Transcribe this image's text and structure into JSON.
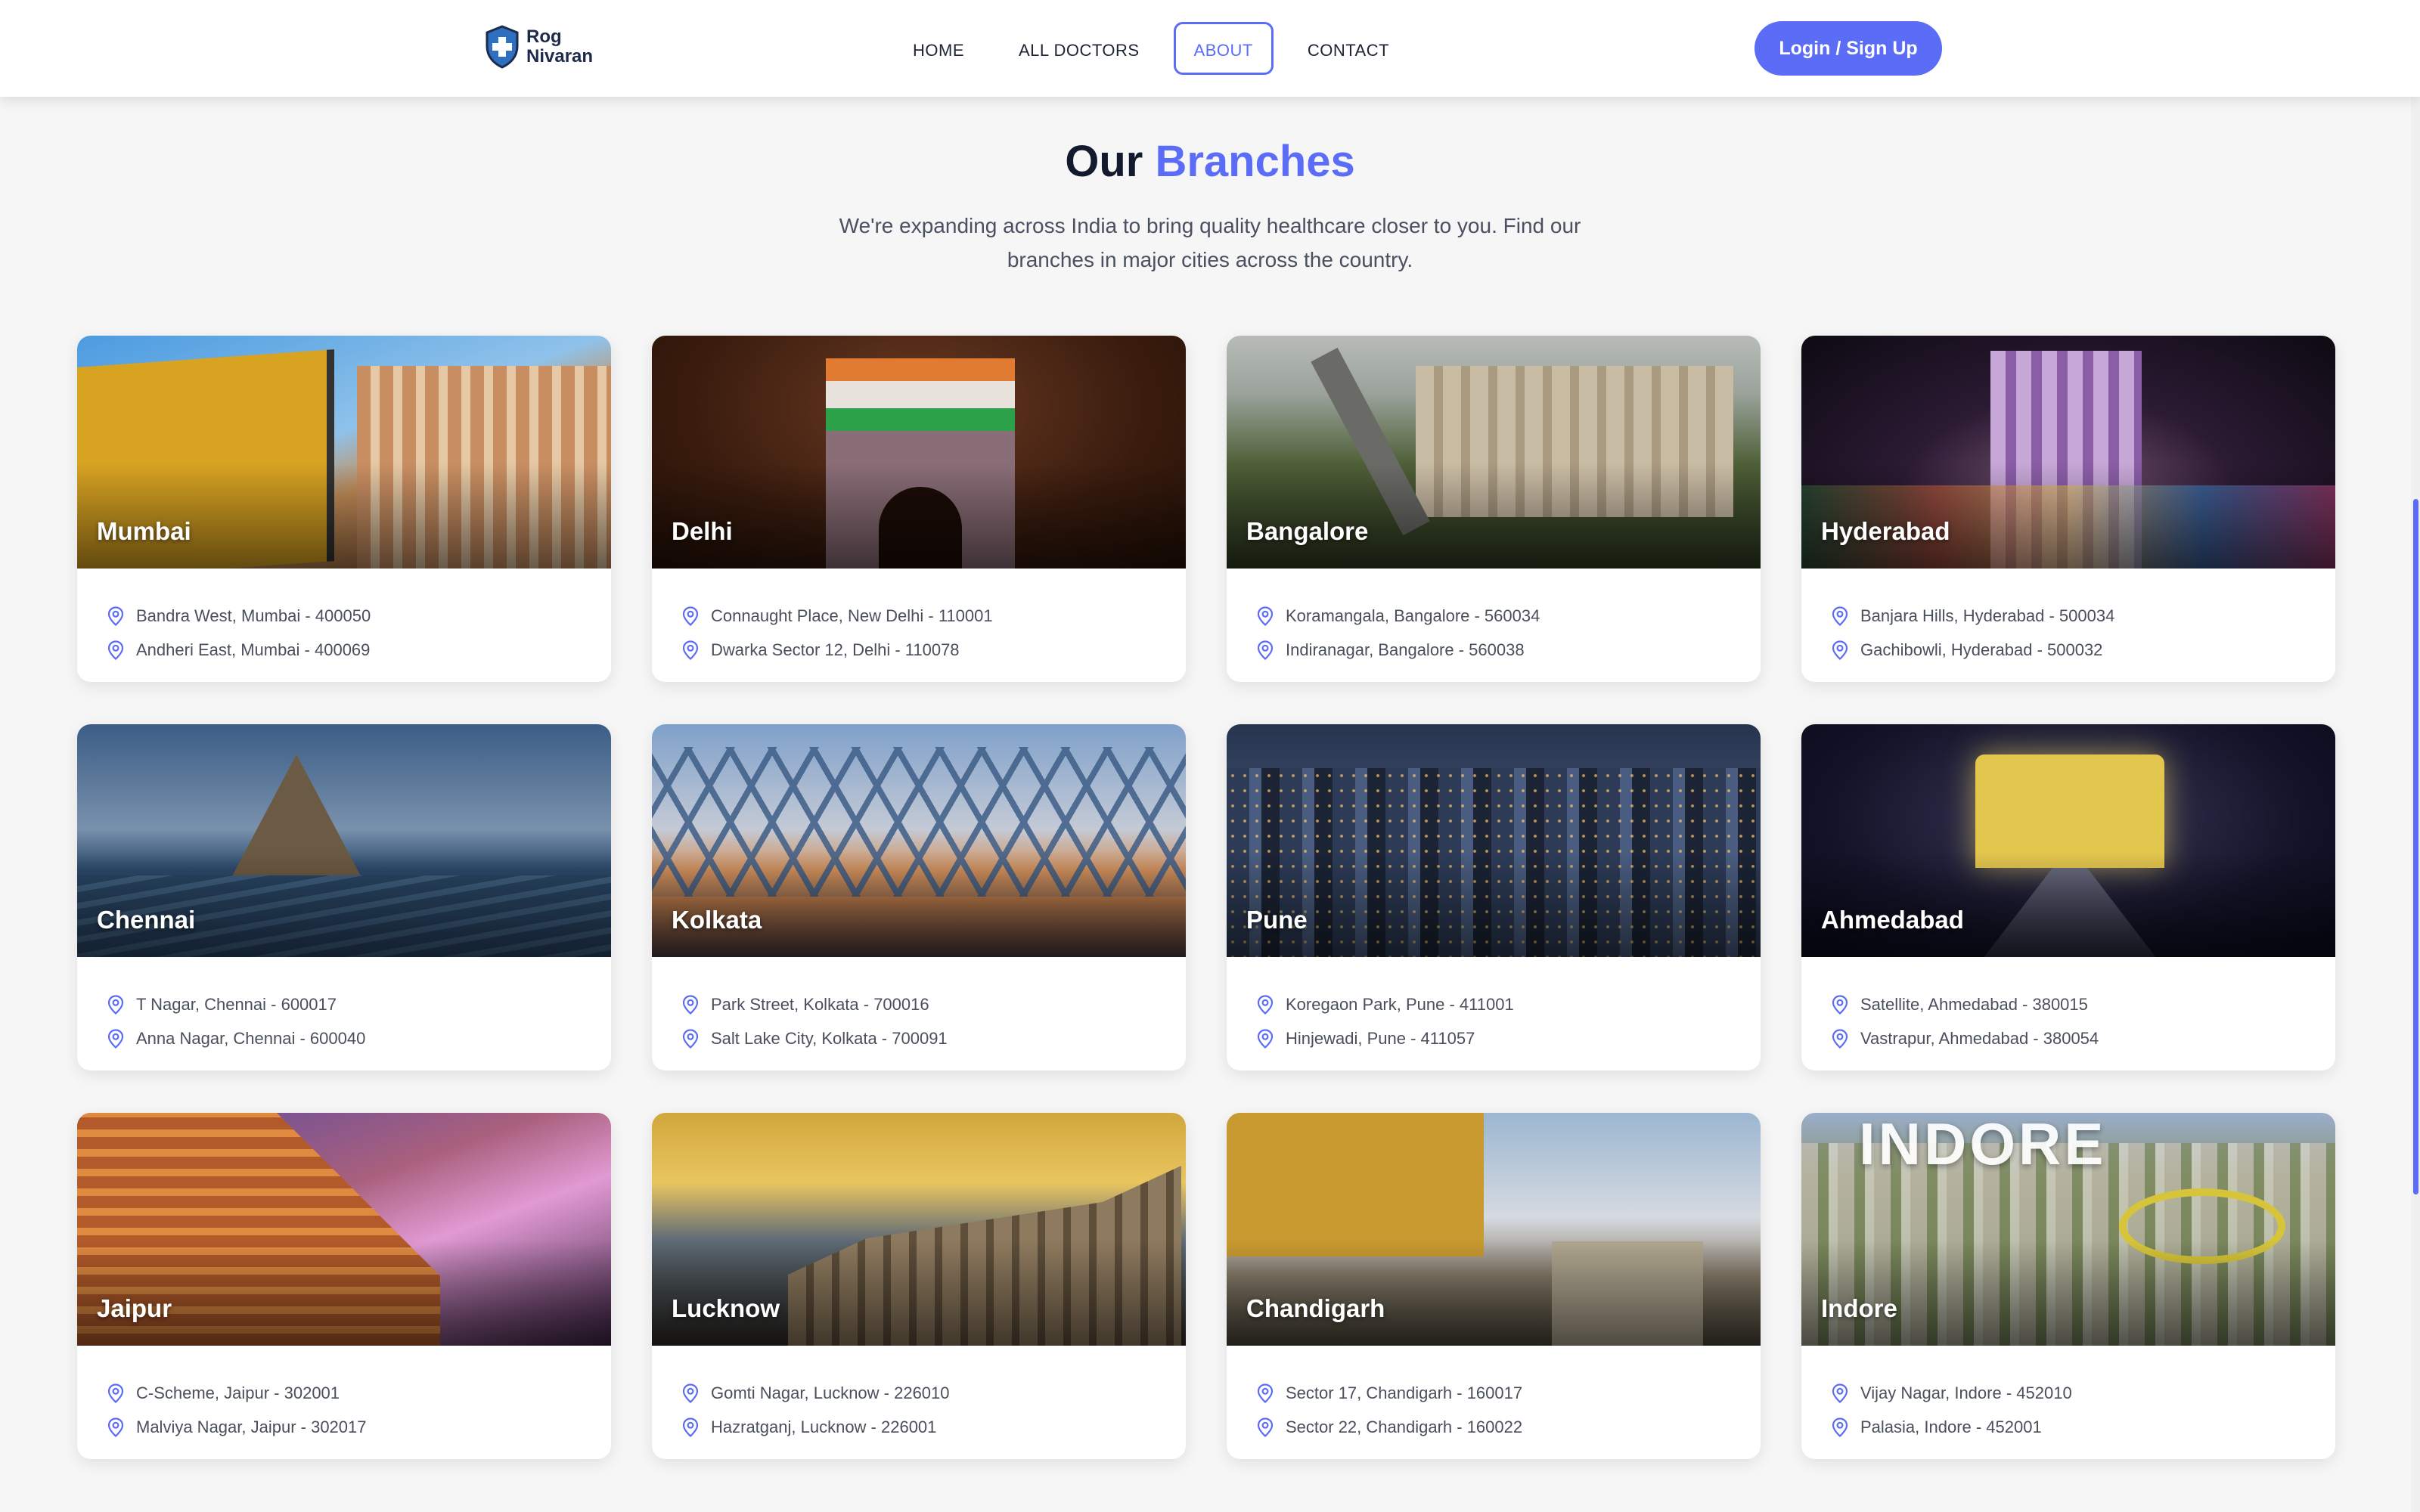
{
  "brand": {
    "line1": "Rog",
    "line2": "Nivaran"
  },
  "nav": {
    "links": [
      {
        "label": "HOME"
      },
      {
        "label": "ALL DOCTORS"
      },
      {
        "label": "ABOUT"
      },
      {
        "label": "CONTACT"
      }
    ],
    "active": "ABOUT",
    "login_label": "Login / Sign Up"
  },
  "colors": {
    "accent": "#5b6cf6",
    "heading": "#141a2e",
    "background": "#f6f6f7"
  },
  "section": {
    "title_plain": "Our",
    "title_accent": "Branches",
    "subtitle": "We're expanding across India to bring quality healthcare closer to you. Find our branches in major cities across the country."
  },
  "icons": {
    "address": "map-pin-icon",
    "logo": "shield-cross-icon"
  },
  "branches": [
    {
      "city": "Mumbai",
      "addresses": [
        "Bandra West, Mumbai - 400050",
        "Andheri East, Mumbai - 400069"
      ]
    },
    {
      "city": "Delhi",
      "addresses": [
        "Connaught Place, New Delhi - 110001",
        "Dwarka Sector 12, Delhi - 110078"
      ]
    },
    {
      "city": "Bangalore",
      "addresses": [
        "Koramangala, Bangalore - 560034",
        "Indiranagar, Bangalore - 560038"
      ]
    },
    {
      "city": "Hyderabad",
      "addresses": [
        "Banjara Hills, Hyderabad - 500034",
        "Gachibowli, Hyderabad - 500032"
      ]
    },
    {
      "city": "Chennai",
      "addresses": [
        "T Nagar, Chennai - 600017",
        "Anna Nagar, Chennai - 600040"
      ]
    },
    {
      "city": "Kolkata",
      "addresses": [
        "Park Street, Kolkata - 700016",
        "Salt Lake City, Kolkata - 700091"
      ]
    },
    {
      "city": "Pune",
      "addresses": [
        "Koregaon Park, Pune - 411001",
        "Hinjewadi, Pune - 411057"
      ]
    },
    {
      "city": "Ahmedabad",
      "addresses": [
        "Satellite, Ahmedabad - 380015",
        "Vastrapur, Ahmedabad - 380054"
      ]
    },
    {
      "city": "Jaipur",
      "addresses": [
        "C-Scheme, Jaipur - 302001",
        "Malviya Nagar, Jaipur - 302017"
      ]
    },
    {
      "city": "Lucknow",
      "addresses": [
        "Gomti Nagar, Lucknow - 226010",
        "Hazratganj, Lucknow - 226001"
      ]
    },
    {
      "city": "Chandigarh",
      "addresses": [
        "Sector 17, Chandigarh - 160017",
        "Sector 22, Chandigarh - 160022"
      ]
    },
    {
      "city": "Indore",
      "addresses": [
        "Vijay Nagar, Indore - 452010",
        "Palasia, Indore - 452001"
      ]
    }
  ]
}
